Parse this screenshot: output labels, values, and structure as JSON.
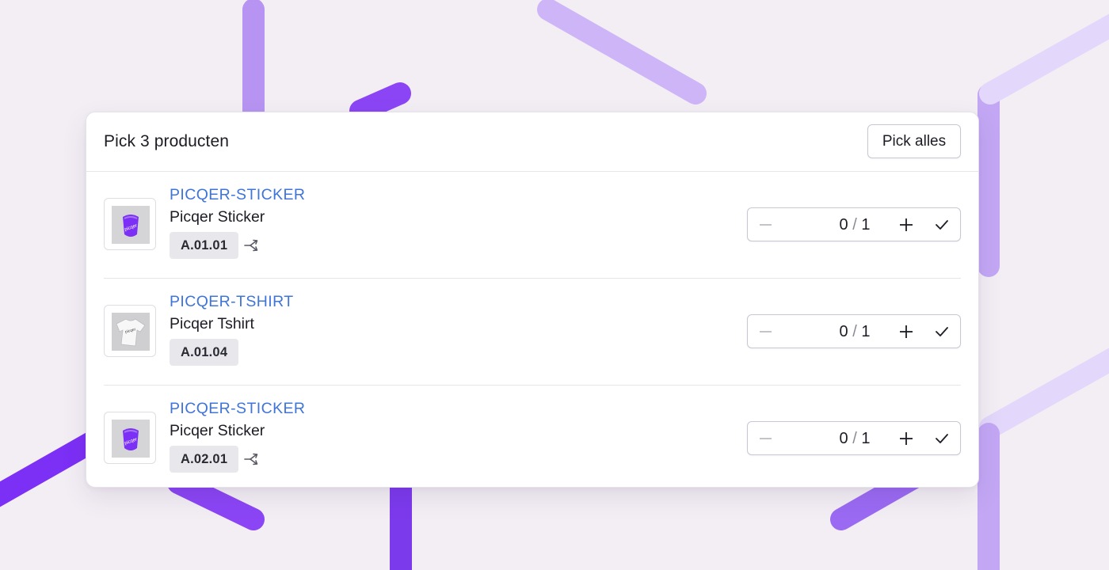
{
  "header": {
    "title": "Pick 3 producten",
    "pick_all_label": "Pick alles"
  },
  "products": [
    {
      "sku": "PICQER-STICKER",
      "name": "Picqer Sticker",
      "location": "A.01.01",
      "has_split_icon": true,
      "image": "sticker",
      "picked": "0",
      "slash": "/",
      "total": "1"
    },
    {
      "sku": "PICQER-TSHIRT",
      "name": "Picqer Tshirt",
      "location": "A.01.04",
      "has_split_icon": false,
      "image": "tshirt",
      "picked": "0",
      "slash": "/",
      "total": "1"
    },
    {
      "sku": "PICQER-STICKER",
      "name": "Picqer Sticker",
      "location": "A.02.01",
      "has_split_icon": true,
      "image": "sticker",
      "picked": "0",
      "slash": "/",
      "total": "1"
    }
  ],
  "icons": {
    "decrement": "minus-icon",
    "increment": "plus-icon",
    "confirm": "check-icon",
    "split": "split-arrows-icon"
  },
  "colors": {
    "sku": "#3f74d9",
    "accent_purple": "#7c3aed",
    "background": "#f3eef4"
  }
}
